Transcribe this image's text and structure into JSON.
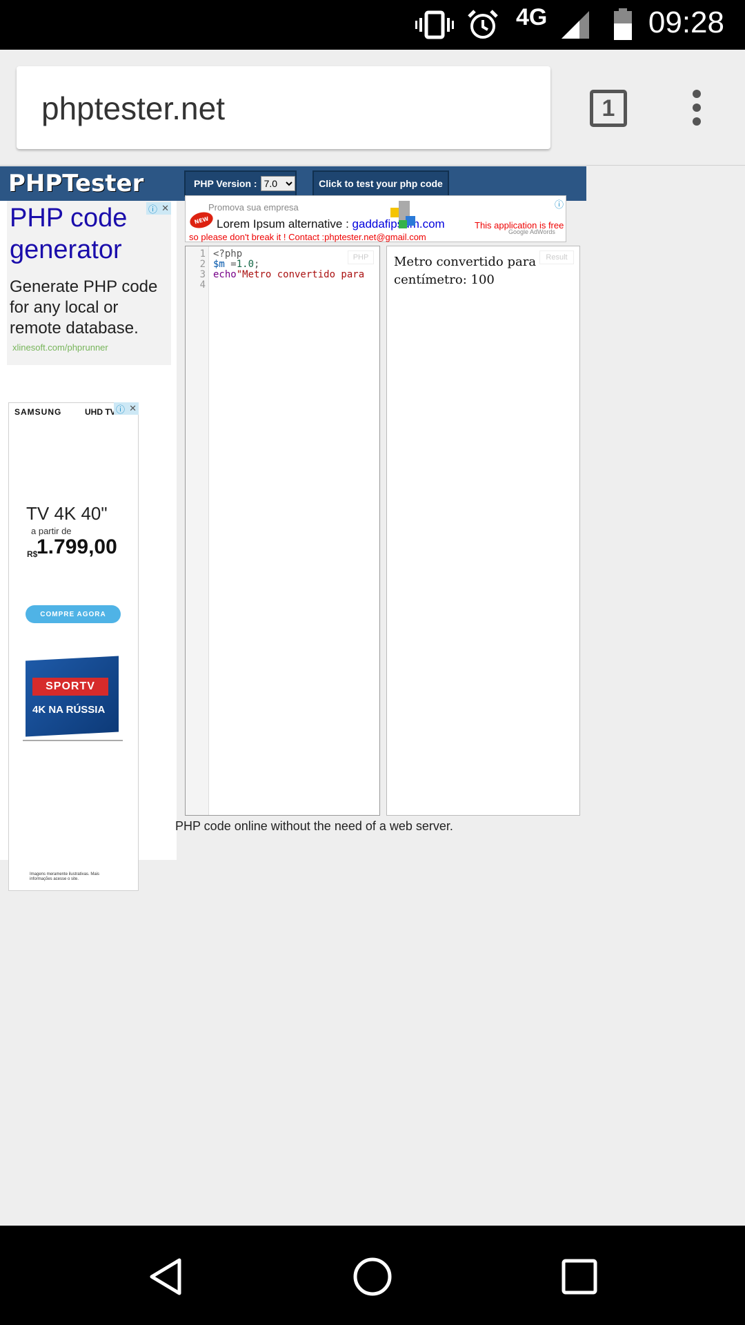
{
  "status_bar": {
    "network": "4G",
    "time": "09:28",
    "icons": [
      "vibrate-icon",
      "alarm-icon",
      "signal-icon",
      "battery-icon"
    ]
  },
  "browser": {
    "url": "phptester.net",
    "tab_count": "1",
    "menu_icon": "more-vert-icon"
  },
  "site": {
    "logo": "PHPTester",
    "php_version_label": "PHP Version :",
    "php_version_selected": "7.0",
    "run_button": "Click to test your php code",
    "footer_text": "PHP code online without the need of a web server."
  },
  "top_ad": {
    "promo": "Promova sua empresa",
    "lorem_prefix": "Lorem Ipsum alternative : ",
    "lorem_link": "gaddafipsum.com",
    "free_text": "This application is free",
    "contact": "so please don't break it ! Contact :phptester.net@gmail.com",
    "adwords": "Google AdWords",
    "new_badge": "NEW"
  },
  "text_ad": {
    "title": "PHP code generator",
    "description": "Generate PHP code for any local or remote database.",
    "url": "xlinesoft.com/phprunner"
  },
  "banner_ad": {
    "brand": "SAMSUNG",
    "brand_line": "UHD TV",
    "tv_title": "TV 4K 40\"",
    "from": "a partir de",
    "currency": "R$",
    "price": "1.799,00",
    "cta": "COMPRE AGORA",
    "sport": "SPORTV",
    "russia": "4K NA RÚSSIA",
    "fine_print": "Imagens meramente ilustrativas. Mais informações acesse o site."
  },
  "editor": {
    "label": "PHP",
    "line_numbers": [
      "1",
      "2",
      "3",
      "4"
    ],
    "lines": {
      "l1": "<?php",
      "l2_var": "$m",
      "l2_eq": " =",
      "l2_num": "1.0",
      "l2_end": ";",
      "l3_fn": "echo",
      "l3_str": "\"Metro convertido para"
    }
  },
  "result": {
    "label": "Result",
    "text": "Metro convertido para centímetro: 100"
  },
  "nav_bar": {
    "back": "back-icon",
    "home": "home-icon",
    "recents": "recents-icon"
  }
}
